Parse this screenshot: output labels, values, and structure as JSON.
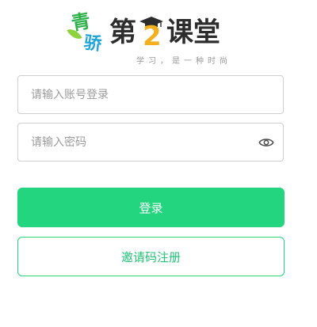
{
  "brand": {
    "mark_top": "青",
    "mark_bottom": "骄",
    "title_prefix": "第",
    "title_number": "2",
    "title_suffix": "课堂",
    "slogan": "学习，是一种时尚",
    "colors": {
      "mark_green": "#2fb24c",
      "mark_blue": "#1fa4d8",
      "number_gold": "#f2b01e",
      "title_dark": "#2c2c2c"
    }
  },
  "login_form": {
    "account_placeholder": "请输入账号登录",
    "password_placeholder": "请输入密码",
    "show_password_icon": "eye-icon",
    "login_label": "登录",
    "register_label": "邀请码注册"
  },
  "theme": {
    "accent": "#23d57e",
    "border": "#cfcfcf",
    "placeholder": "#9b9b9b"
  }
}
